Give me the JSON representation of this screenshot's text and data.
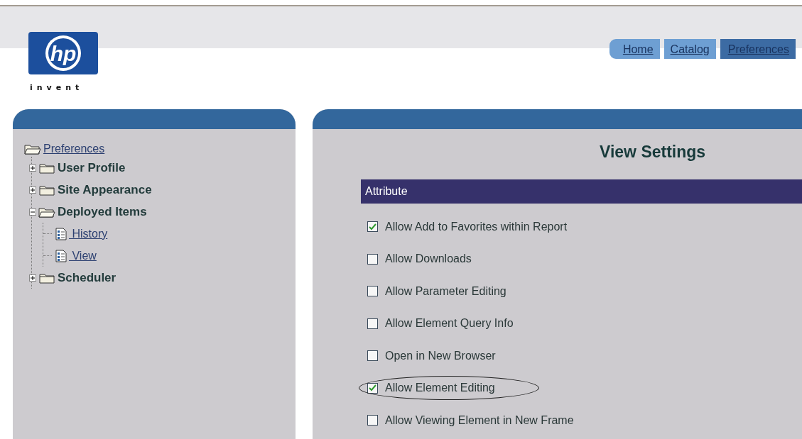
{
  "logo": {
    "mark": "hp",
    "tagline": "invent"
  },
  "nav": [
    {
      "label": "Home",
      "selected": false
    },
    {
      "label": "Catalog",
      "selected": false
    },
    {
      "label": "Preferences",
      "selected": true
    }
  ],
  "tree": [
    {
      "label": "Preferences",
      "kind": "root",
      "expanded": true,
      "children": [
        {
          "label": "User Profile",
          "kind": "folder",
          "expanded": false
        },
        {
          "label": "Site Appearance",
          "kind": "folder",
          "expanded": false
        },
        {
          "label": "Deployed Items",
          "kind": "folder",
          "expanded": true,
          "children": [
            {
              "label": " History",
              "kind": "page"
            },
            {
              "label": " View",
              "kind": "page"
            }
          ]
        },
        {
          "label": "Scheduler",
          "kind": "folder",
          "expanded": false
        }
      ]
    }
  ],
  "settings": {
    "title": "View Settings",
    "column": "Attribute",
    "options": [
      {
        "label": "Allow Add to Favorites within Report",
        "checked": true,
        "circled": false
      },
      {
        "label": "Allow Downloads",
        "checked": false,
        "circled": false
      },
      {
        "label": "Allow Parameter Editing",
        "checked": false,
        "circled": false
      },
      {
        "label": "Allow Element Query Info",
        "checked": false,
        "circled": false
      },
      {
        "label": "Open in New Browser",
        "checked": false,
        "circled": false
      },
      {
        "label": "Allow Element Editing",
        "checked": true,
        "circled": true
      },
      {
        "label": "Allow Viewing Element in New Frame",
        "checked": false,
        "circled": false
      }
    ]
  }
}
